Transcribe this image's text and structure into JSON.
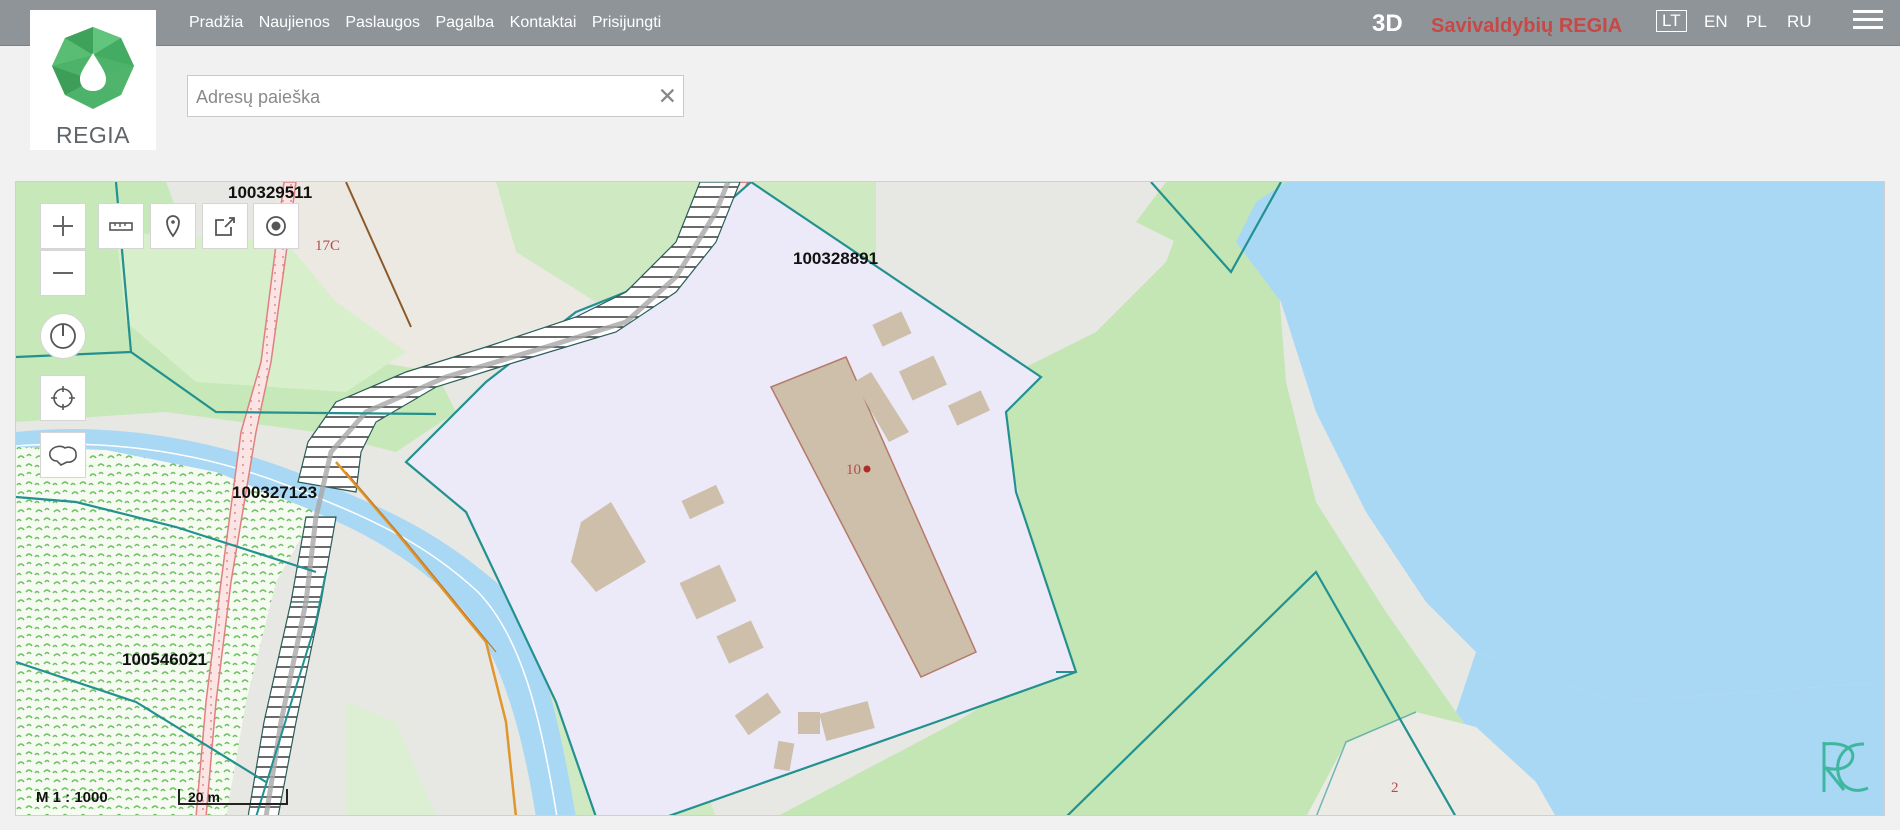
{
  "header": {
    "nav": [
      "Pradžia",
      "Naujienos",
      "Paslaugos",
      "Pagalba",
      "Kontaktai",
      "Prisijungti"
    ],
    "btn_3d": "3D",
    "municipality_label": "Savivaldybių REGIA",
    "languages": [
      "LT",
      "EN",
      "PL",
      "RU"
    ],
    "active_language": "LT",
    "menu_icon": "hamburger-menu-icon"
  },
  "logo": {
    "text": "REGIA"
  },
  "search": {
    "placeholder": "Adresų paieška",
    "value": "",
    "clear_icon": "close-icon"
  },
  "map": {
    "parcel_labels": [
      "100329511",
      "100328891",
      "100327123",
      "100546021"
    ],
    "address_labels": [
      "17C",
      "10",
      "2"
    ],
    "scale_text": "M 1 : 1000",
    "scalebar_text": "20 m",
    "colors": {
      "water": "#a9d8f5",
      "forest": "#c3e6b4",
      "parcel_border": "#23918f",
      "parcel_fill": "#ece9f8",
      "building": "#cdbfa9",
      "road": "#b9b9b9"
    }
  },
  "tools": {
    "zoom_in": "plus-icon",
    "zoom_out": "minus-icon",
    "compass": "compass-icon",
    "locate": "crosshair-icon",
    "extent": "region-outline-icon",
    "measure": "ruler-icon",
    "marker": "map-pin-icon",
    "share": "share-icon",
    "target": "target-icon"
  }
}
